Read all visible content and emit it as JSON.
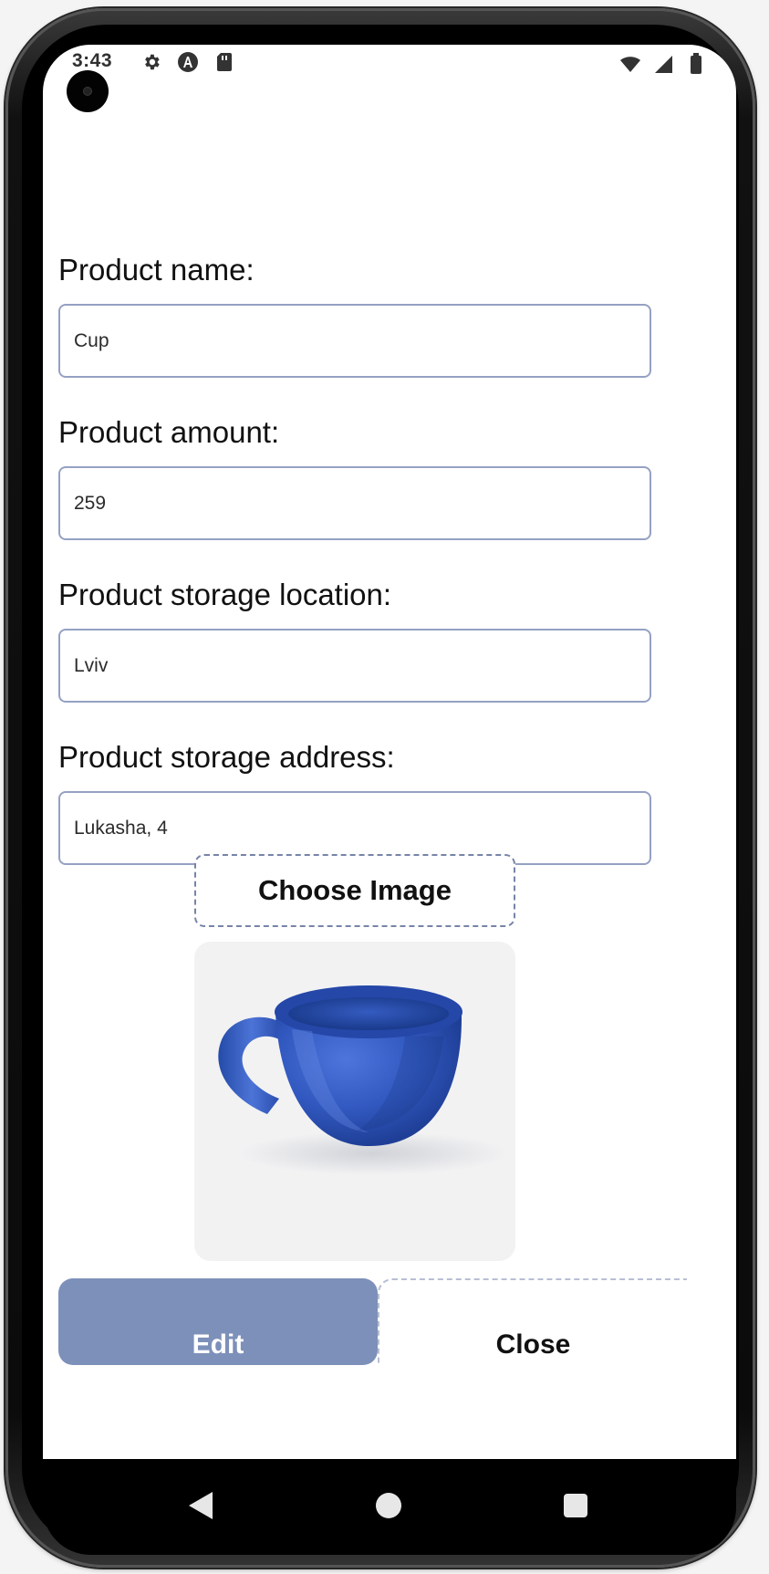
{
  "status_bar": {
    "time": "3:43",
    "icons": [
      "gear-icon",
      "a-icon",
      "sd-card-icon",
      "wifi-icon",
      "signal-icon",
      "battery-icon"
    ]
  },
  "form": {
    "product_name_label": "Product name:",
    "product_name_value": "Cup",
    "product_amount_label": "Product amount:",
    "product_amount_value": "259",
    "storage_location_label": "Product storage location:",
    "storage_location_value": "Lviv",
    "storage_address_label": "Product storage address:",
    "storage_address_value": "Lukasha, 4"
  },
  "image_picker": {
    "choose_image_label": "Choose Image",
    "preview_icon": "cup-image"
  },
  "actions": {
    "edit_label": "Edit",
    "close_label": "Close"
  },
  "theme": {
    "accent": "#7d90ba",
    "input_border": "#95a1c3",
    "cup_blue": "#3158bf"
  },
  "navigation": {
    "icons": [
      "back-icon",
      "home-icon",
      "recents-icon"
    ]
  }
}
